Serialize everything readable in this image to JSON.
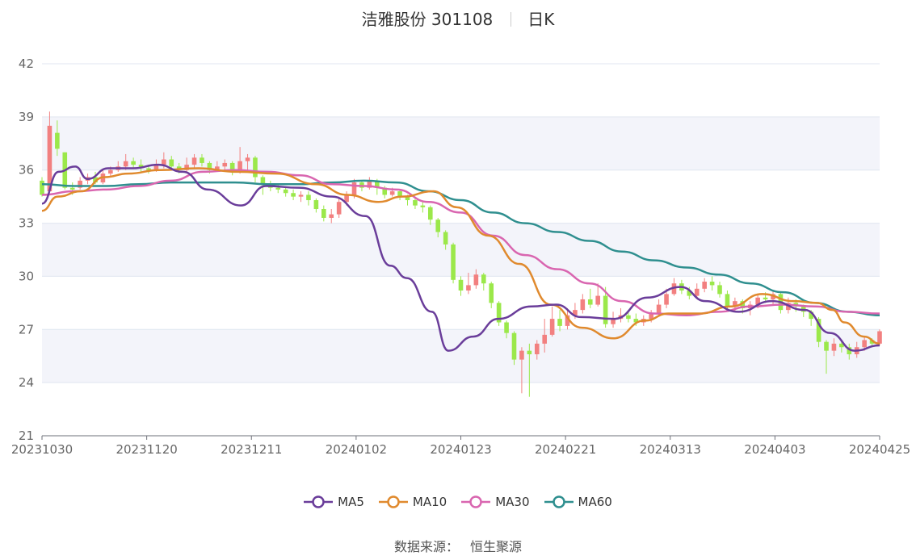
{
  "title": {
    "name": "洁雅股份 301108",
    "period": "日K"
  },
  "footer": {
    "label": "数据来源：",
    "source": "恒生聚源"
  },
  "legend": [
    {
      "name": "MA5",
      "color": "#6a3d9a"
    },
    {
      "name": "MA10",
      "color": "#e08a2e"
    },
    {
      "name": "MA30",
      "color": "#d966b0"
    },
    {
      "name": "MA60",
      "color": "#2f8f8f"
    }
  ],
  "colors": {
    "up": "#f28080",
    "down": "#9be84a",
    "grid": "#e0e6f0",
    "band": "#f3f4fa"
  },
  "chart_data": {
    "type": "candlestick",
    "ylim": [
      21,
      42
    ],
    "yticks": [
      21,
      24,
      27,
      30,
      33,
      36,
      39,
      42
    ],
    "xlabels": [
      "20231030",
      "20231120",
      "20231211",
      "20240102",
      "20240123",
      "20240221",
      "20240313",
      "20240403",
      "20240425"
    ],
    "candles": [
      [
        35.4,
        34.6,
        35.6,
        34.5
      ],
      [
        34.8,
        38.5,
        39.3,
        34.7
      ],
      [
        38.1,
        37.2,
        38.8,
        36.8
      ],
      [
        37.0,
        35.0,
        37.0,
        34.9
      ],
      [
        35.0,
        34.9,
        35.3,
        34.6
      ],
      [
        35.0,
        35.4,
        35.6,
        34.9
      ],
      [
        35.4,
        35.6,
        35.8,
        35.2
      ],
      [
        35.6,
        35.3,
        35.9,
        35.2
      ],
      [
        35.3,
        35.8,
        36.0,
        35.2
      ],
      [
        35.8,
        36.0,
        36.2,
        35.6
      ],
      [
        36.0,
        36.2,
        36.5,
        35.9
      ],
      [
        36.2,
        36.5,
        36.9,
        36.0
      ],
      [
        36.5,
        36.3,
        36.7,
        36.1
      ],
      [
        36.3,
        36.1,
        36.6,
        35.9
      ],
      [
        36.1,
        36.0,
        36.3,
        35.8
      ],
      [
        36.0,
        36.3,
        36.6,
        35.9
      ],
      [
        36.3,
        36.6,
        37.0,
        36.1
      ],
      [
        36.6,
        36.2,
        36.8,
        36.0
      ],
      [
        36.2,
        36.0,
        36.4,
        35.8
      ],
      [
        36.0,
        36.3,
        36.7,
        35.9
      ],
      [
        36.3,
        36.7,
        36.9,
        36.1
      ],
      [
        36.7,
        36.4,
        36.9,
        36.2
      ],
      [
        36.4,
        36.0,
        36.5,
        35.8
      ],
      [
        36.0,
        36.2,
        36.5,
        35.9
      ],
      [
        36.2,
        36.4,
        36.6,
        36.0
      ],
      [
        36.4,
        35.9,
        36.5,
        35.7
      ],
      [
        35.9,
        36.5,
        37.3,
        35.8
      ],
      [
        36.5,
        36.7,
        36.9,
        36.0
      ],
      [
        36.7,
        35.6,
        36.8,
        35.3
      ],
      [
        35.6,
        35.2,
        35.7,
        34.6
      ],
      [
        35.2,
        35.0,
        35.4,
        34.8
      ],
      [
        35.0,
        34.9,
        35.2,
        34.7
      ],
      [
        34.9,
        34.7,
        35.0,
        34.5
      ],
      [
        34.7,
        34.5,
        34.9,
        34.3
      ],
      [
        34.5,
        34.6,
        34.8,
        34.2
      ],
      [
        34.6,
        34.3,
        34.8,
        34.0
      ],
      [
        34.3,
        33.8,
        34.4,
        33.6
      ],
      [
        33.8,
        33.3,
        34.0,
        33.1
      ],
      [
        33.3,
        33.5,
        33.8,
        33.0
      ],
      [
        33.5,
        34.2,
        34.5,
        33.3
      ],
      [
        34.2,
        34.6,
        34.8,
        34.0
      ],
      [
        34.6,
        35.3,
        35.5,
        34.4
      ],
      [
        35.3,
        35.0,
        35.4,
        34.8
      ],
      [
        35.0,
        35.4,
        35.6,
        34.9
      ],
      [
        35.4,
        35.0,
        35.5,
        34.6
      ],
      [
        35.0,
        34.6,
        35.1,
        34.4
      ],
      [
        34.6,
        34.8,
        35.0,
        34.5
      ],
      [
        34.8,
        34.5,
        34.9,
        34.3
      ],
      [
        34.5,
        34.3,
        34.6,
        34.0
      ],
      [
        34.3,
        34.0,
        34.4,
        33.8
      ],
      [
        34.0,
        33.9,
        34.2,
        33.6
      ],
      [
        33.9,
        33.2,
        34.0,
        32.9
      ],
      [
        33.2,
        32.5,
        33.3,
        32.2
      ],
      [
        32.5,
        31.8,
        32.6,
        31.5
      ],
      [
        31.8,
        29.8,
        31.9,
        29.6
      ],
      [
        29.8,
        29.2,
        30.0,
        28.9
      ],
      [
        29.2,
        29.5,
        30.2,
        29.0
      ],
      [
        29.5,
        30.1,
        30.4,
        29.3
      ],
      [
        30.1,
        29.6,
        30.2,
        29.2
      ],
      [
        29.6,
        28.5,
        29.7,
        28.2
      ],
      [
        28.5,
        27.4,
        28.6,
        27.2
      ],
      [
        27.4,
        26.8,
        27.5,
        26.5
      ],
      [
        26.8,
        25.3,
        26.9,
        25.0
      ],
      [
        25.3,
        25.8,
        26.0,
        23.4
      ],
      [
        25.8,
        25.6,
        26.2,
        23.2
      ],
      [
        25.6,
        26.2,
        26.4,
        25.3
      ],
      [
        26.2,
        26.7,
        27.6,
        25.7
      ],
      [
        26.7,
        27.6,
        28.3,
        26.6
      ],
      [
        27.6,
        27.2,
        28.1,
        26.9
      ],
      [
        27.2,
        27.8,
        28.2,
        27.0
      ],
      [
        27.8,
        28.1,
        28.5,
        27.6
      ],
      [
        28.1,
        28.7,
        29.0,
        27.9
      ],
      [
        28.7,
        28.4,
        29.3,
        28.2
      ],
      [
        28.4,
        28.9,
        29.6,
        28.3
      ],
      [
        28.9,
        27.3,
        29.4,
        27.1
      ],
      [
        27.3,
        27.6,
        28.0,
        27.1
      ],
      [
        27.6,
        27.8,
        28.2,
        27.4
      ],
      [
        27.8,
        27.6,
        28.1,
        27.4
      ],
      [
        27.6,
        27.4,
        27.9,
        27.2
      ],
      [
        27.4,
        27.6,
        27.8,
        27.2
      ],
      [
        27.6,
        27.9,
        28.1,
        27.4
      ],
      [
        27.9,
        28.4,
        28.7,
        27.8
      ],
      [
        28.4,
        29.0,
        29.3,
        28.2
      ],
      [
        29.0,
        29.6,
        29.9,
        28.9
      ],
      [
        29.6,
        29.2,
        29.8,
        29.0
      ],
      [
        29.2,
        28.9,
        29.4,
        28.7
      ],
      [
        28.9,
        29.3,
        29.6,
        28.8
      ],
      [
        29.3,
        29.7,
        29.9,
        29.1
      ],
      [
        29.7,
        29.5,
        30.0,
        29.2
      ],
      [
        29.5,
        29.0,
        29.7,
        28.8
      ],
      [
        29.0,
        28.3,
        29.2,
        28.1
      ],
      [
        28.3,
        28.6,
        28.8,
        28.0
      ],
      [
        28.6,
        28.2,
        28.7,
        27.9
      ],
      [
        28.2,
        28.4,
        28.6,
        27.8
      ],
      [
        28.4,
        28.8,
        29.0,
        28.2
      ],
      [
        28.8,
        28.7,
        29.1,
        28.5
      ],
      [
        28.7,
        29.0,
        29.2,
        28.4
      ],
      [
        29.0,
        28.1,
        29.1,
        27.9
      ],
      [
        28.1,
        28.5,
        28.8,
        27.9
      ],
      [
        28.5,
        28.3,
        28.7,
        28.0
      ],
      [
        28.3,
        28.0,
        28.4,
        27.7
      ],
      [
        28.0,
        27.6,
        28.1,
        27.2
      ],
      [
        27.6,
        26.3,
        27.7,
        26.0
      ],
      [
        26.3,
        25.8,
        26.4,
        24.5
      ],
      [
        25.8,
        26.2,
        26.5,
        25.5
      ],
      [
        26.2,
        26.0,
        26.4,
        25.7
      ],
      [
        26.0,
        25.6,
        26.2,
        25.3
      ],
      [
        25.6,
        26.0,
        26.3,
        25.4
      ],
      [
        26.0,
        26.4,
        26.6,
        25.8
      ],
      [
        26.4,
        26.2,
        26.5,
        26.0
      ],
      [
        26.2,
        26.9,
        27.0,
        26.1
      ]
    ],
    "ma": {
      "MA5": [
        [
          0,
          34.1
        ],
        [
          4,
          35.9
        ],
        [
          8,
          36.2
        ],
        [
          11,
          35.5
        ],
        [
          16,
          36.1
        ],
        [
          22,
          36.1
        ],
        [
          28,
          36.3
        ],
        [
          34,
          35.9
        ],
        [
          40,
          34.9
        ],
        [
          48,
          34.0
        ],
        [
          54,
          35.1
        ],
        [
          62,
          35.0
        ],
        [
          70,
          34.5
        ],
        [
          78,
          33.4
        ],
        [
          84,
          30.6
        ],
        [
          88,
          29.9
        ],
        [
          94,
          28.0
        ],
        [
          98,
          25.8
        ],
        [
          104,
          26.6
        ],
        [
          110,
          27.6
        ],
        [
          118,
          28.3
        ],
        [
          124,
          28.4
        ],
        [
          130,
          27.7
        ],
        [
          138,
          27.6
        ],
        [
          146,
          28.8
        ],
        [
          154,
          29.4
        ],
        [
          160,
          28.6
        ],
        [
          168,
          28.0
        ],
        [
          176,
          28.6
        ],
        [
          184,
          28.1
        ],
        [
          190,
          26.8
        ],
        [
          196,
          25.8
        ],
        [
          202,
          26.1
        ]
      ],
      "MA10": [
        [
          0,
          33.7
        ],
        [
          4,
          34.5
        ],
        [
          10,
          34.8
        ],
        [
          16,
          35.6
        ],
        [
          22,
          35.8
        ],
        [
          30,
          36.0
        ],
        [
          40,
          36.1
        ],
        [
          50,
          35.9
        ],
        [
          60,
          35.8
        ],
        [
          70,
          35.2
        ],
        [
          78,
          34.6
        ],
        [
          86,
          34.2
        ],
        [
          92,
          34.5
        ],
        [
          100,
          34.8
        ],
        [
          106,
          33.9
        ],
        [
          114,
          32.3
        ],
        [
          122,
          30.7
        ],
        [
          130,
          28.4
        ],
        [
          138,
          27.1
        ],
        [
          146,
          26.5
        ],
        [
          154,
          27.5
        ],
        [
          160,
          27.9
        ],
        [
          168,
          27.9
        ],
        [
          176,
          28.3
        ],
        [
          184,
          29.0
        ],
        [
          192,
          28.6
        ],
        [
          198,
          28.5
        ],
        [
          202,
          28.1
        ],
        [
          205,
          27.4
        ],
        [
          210,
          26.6
        ],
        [
          214,
          26.2
        ]
      ],
      "MA30": [
        [
          0,
          34.6
        ],
        [
          10,
          34.8
        ],
        [
          20,
          34.9
        ],
        [
          30,
          35.1
        ],
        [
          40,
          35.4
        ],
        [
          50,
          35.9
        ],
        [
          60,
          36.0
        ],
        [
          70,
          35.9
        ],
        [
          80,
          35.7
        ],
        [
          90,
          35.2
        ],
        [
          100,
          35.1
        ],
        [
          110,
          34.9
        ],
        [
          120,
          34.2
        ],
        [
          130,
          33.6
        ],
        [
          140,
          32.3
        ],
        [
          150,
          31.2
        ],
        [
          160,
          30.4
        ],
        [
          170,
          29.6
        ],
        [
          180,
          28.6
        ],
        [
          190,
          27.9
        ],
        [
          200,
          27.8
        ],
        [
          210,
          28.0
        ],
        [
          220,
          28.3
        ],
        [
          230,
          28.4
        ],
        [
          240,
          28.3
        ],
        [
          250,
          28.0
        ],
        [
          260,
          27.9
        ]
      ],
      "MA60": [
        [
          0,
          35.2
        ],
        [
          10,
          35.1
        ],
        [
          20,
          35.1
        ],
        [
          30,
          35.2
        ],
        [
          40,
          35.3
        ],
        [
          50,
          35.3
        ],
        [
          60,
          35.3
        ],
        [
          70,
          35.2
        ],
        [
          80,
          35.2
        ],
        [
          90,
          35.3
        ],
        [
          100,
          35.4
        ],
        [
          110,
          35.3
        ],
        [
          120,
          34.8
        ],
        [
          130,
          34.3
        ],
        [
          140,
          33.6
        ],
        [
          150,
          33.0
        ],
        [
          160,
          32.5
        ],
        [
          170,
          32.0
        ],
        [
          180,
          31.4
        ],
        [
          190,
          30.9
        ],
        [
          200,
          30.5
        ],
        [
          210,
          30.1
        ],
        [
          220,
          29.6
        ],
        [
          230,
          29.1
        ],
        [
          240,
          28.5
        ],
        [
          250,
          28.0
        ],
        [
          260,
          27.8
        ]
      ]
    }
  }
}
